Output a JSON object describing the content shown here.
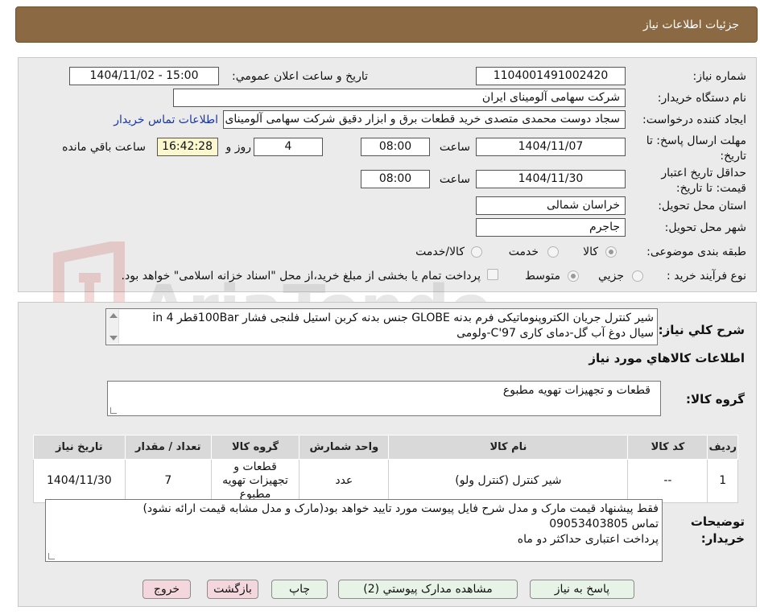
{
  "page": {
    "title": "جزئیات اطلاعات نیاز"
  },
  "watermark": {
    "text": "AriaTender.neT"
  },
  "form": {
    "need_number_label": "شماره نیاز:",
    "need_number": "1104001491002420",
    "announce_label": "تاریخ و ساعت اعلان عمومي:",
    "announce_value": "1404/11/02 - 15:00",
    "buyer_org_label": "نام دستگاه خریدار:",
    "buyer_org": "شرکت سهامی آلومینای ایران",
    "requester_label": "ایجاد کننده درخواست:",
    "requester": "سجاد دوست محمدی متصدی خرید قطعات برق و ابزار دقیق شرکت سهامی آلومینای ایران",
    "contact_link": "اطلاعات تماس خریدار",
    "deadline_label": "مهلت ارسال پاسخ: تا تاریخ:",
    "deadline_date": "1404/11/07",
    "time_label": "ساعت",
    "deadline_time": "08:00",
    "days_value": "4",
    "days_label": "روز و",
    "remaining_time": "16:42:28",
    "remaining_label": "ساعت باقي مانده",
    "validity_label": "حداقل تاریخ اعتبار قیمت: تا تاریخ:",
    "validity_date": "1404/11/30",
    "validity_time": "08:00",
    "province_label": "استان محل تحویل:",
    "province": "خراسان شمالی",
    "city_label": "شهر محل تحویل:",
    "city": "جاجرم",
    "category_label": "طبقه بندی موضوعی:",
    "category_options": [
      "کالا",
      "خدمت",
      "کالا/خدمت"
    ],
    "process_label": "نوع فرآیند خرید :",
    "process_options": [
      "جزیي",
      "متوسط"
    ],
    "payment_note": "پرداخت تمام یا بخشی از مبلغ خرید،از محل \"اسناد خزانه اسلامی\" خواهد بود."
  },
  "details": {
    "summary_label": "شرح كلي نياز:",
    "summary_line1": "شیر کنترل جریان الکتروپنوماتیکی فرم بدنه GLOBE جنس بدنه کربن استیل فلنجی فشار 100Barقطر 4 in",
    "summary_line2": "سیال دوغ آب گل-دمای کاری C'97-ولومی",
    "goods_info_title": "اطلاعات كالاهاي مورد نياز",
    "goods_group_label": "گروه کالا:",
    "goods_group_value": "قطعات و تجهیزات تهویه مطبوع",
    "table": {
      "headers": [
        "ردیف",
        "کد کالا",
        "نام کالا",
        "واحد شمارش",
        "گروه کالا",
        "تعداد / مقدار",
        "تاریخ نیاز"
      ],
      "rows": [
        [
          "1",
          "--",
          "شیر کنترل (کنترل ولو)",
          "عدد",
          "قطعات و تجهیزات تهویه مطبوع",
          "7",
          "1404/11/30"
        ]
      ]
    },
    "buyer_notes_label": "توضیحات خریدار:",
    "buyer_notes_line1": "فقط پیشنهاد قیمت مارک و مدل شرح فایل پیوست مورد تایید خواهد بود(مارک و مدل مشابه قیمت ارائه نشود)",
    "buyer_notes_line2": "تماس 09053403805",
    "buyer_notes_line3": "پرداخت اعتباری حداکثر دو ماه"
  },
  "buttons": {
    "reply": "پاسخ به نیاز",
    "attachments": "مشاهده مدارک پیوستي (2)",
    "print": "چاپ",
    "back": "بازگشت",
    "exit": "خروج"
  }
}
